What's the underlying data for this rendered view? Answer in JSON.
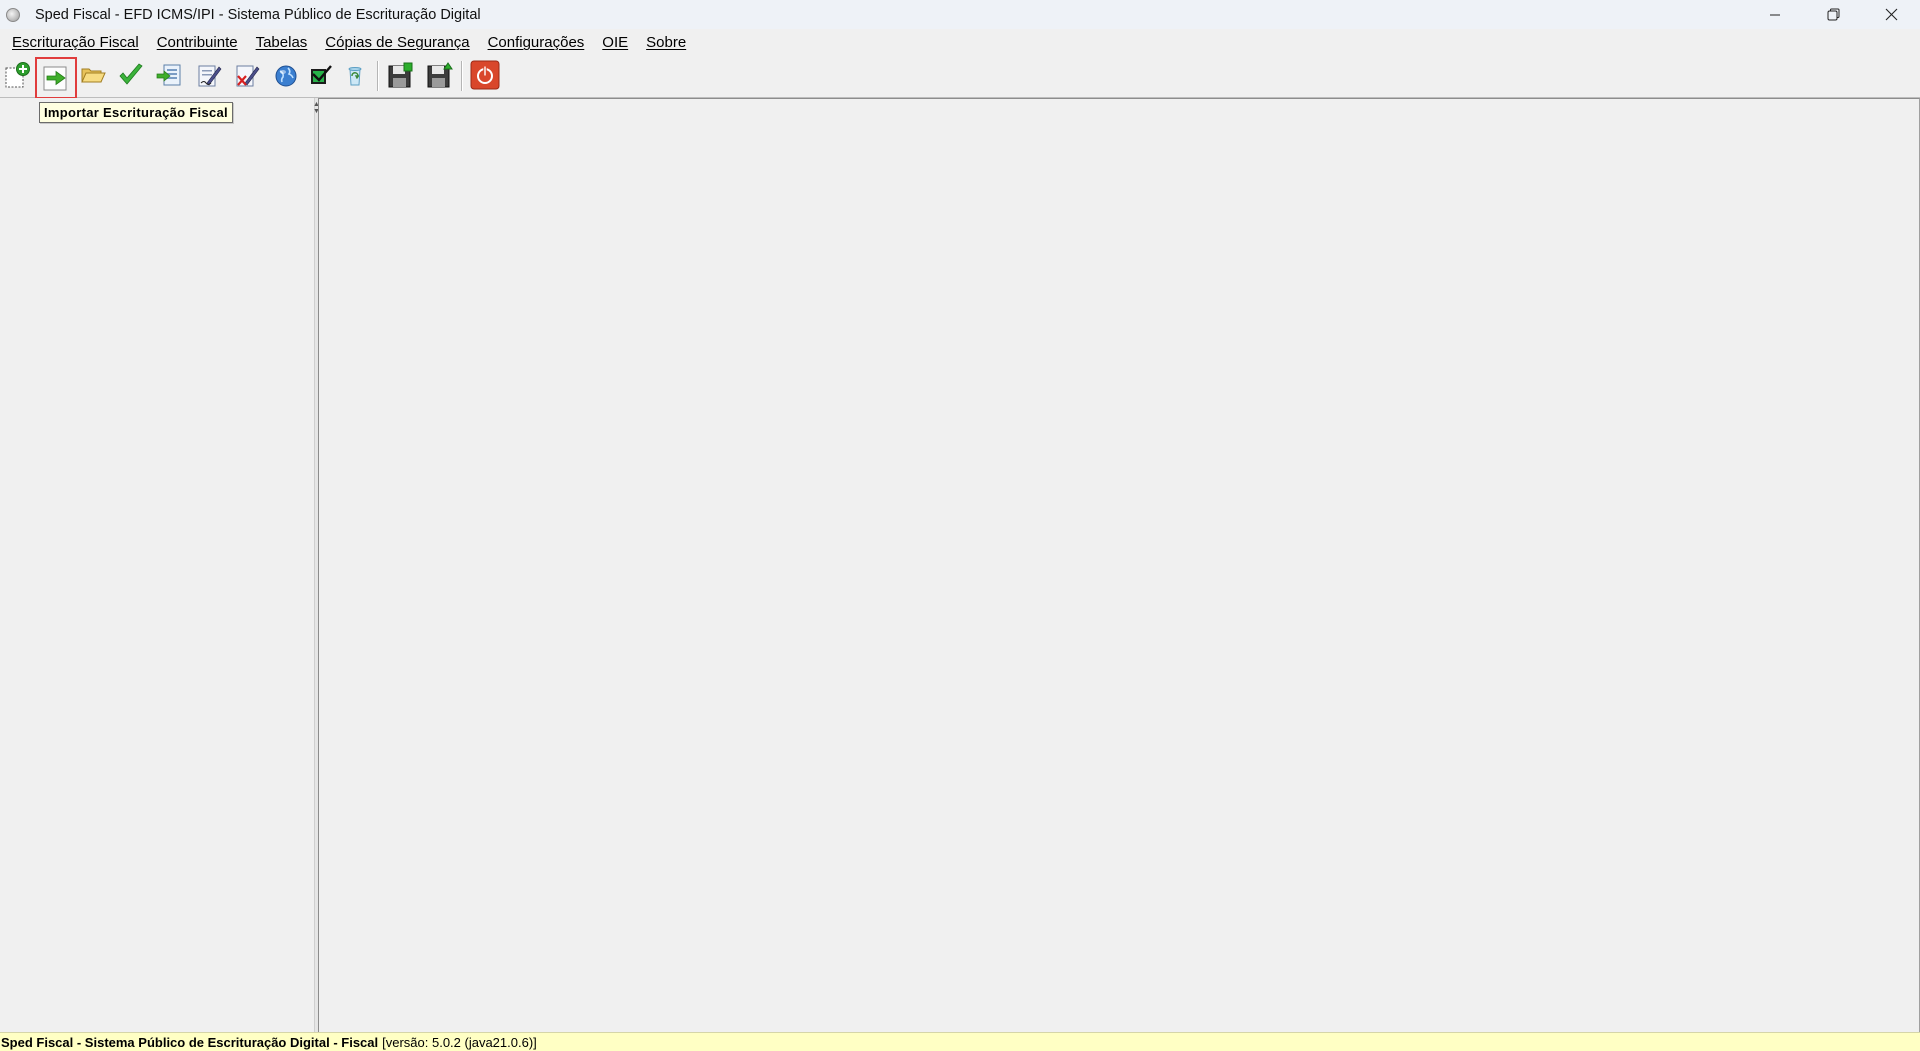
{
  "window": {
    "title": "Sped Fiscal - EFD ICMS/IPI - Sistema Público de Escrituração Digital",
    "controls": [
      "minimize-icon",
      "restore-icon",
      "close-icon"
    ]
  },
  "menubar": {
    "items": [
      {
        "label": "Escrituração Fiscal"
      },
      {
        "label": "Contribuinte"
      },
      {
        "label": "Tabelas"
      },
      {
        "label": "Cópias de Segurança"
      },
      {
        "label": "Configurações"
      },
      {
        "label": "OIE"
      },
      {
        "label": "Sobre"
      }
    ]
  },
  "toolbar": {
    "icons": [
      "new-bookkeeping-icon",
      "import-bookkeeping-icon",
      "open-folder-icon",
      "validate-check-icon",
      "export-icon",
      "sign-document-icon",
      "remove-signature-icon",
      "transmit-globe-icon",
      "checklist-icon",
      "recycle-icon",
      "backup-save-icon",
      "restore-save-icon",
      "exit-power-icon"
    ],
    "highlighted": "import-bookkeeping-icon",
    "highlight_color": "#e03c3c"
  },
  "tooltip": {
    "text": "Importar Escrituração Fiscal"
  },
  "statusbar": {
    "app_name": "Sped Fiscal - Sistema Público de Escrituração Digital - Fiscal",
    "version": "[versão: 5.0.2 (java21.0.6)]",
    "background": "#ffffc4"
  }
}
